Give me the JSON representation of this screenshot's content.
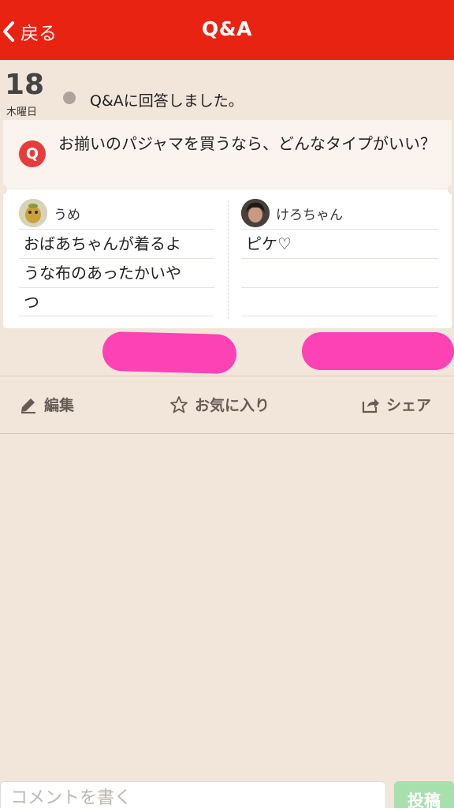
{
  "header": {
    "back_label": "戻る",
    "title": "Q&A"
  },
  "entry": {
    "date_number": "18",
    "weekday": "木曜日",
    "status_text": "Q&Aに回答しました。"
  },
  "question": {
    "badge": "Q",
    "text": "お揃いのパジャマを買うなら、どんなタイプがいい？"
  },
  "answers": [
    {
      "user": "うめ",
      "lines": [
        "おばあちゃんが着るよ",
        "うな布のあったかいや",
        "つ"
      ]
    },
    {
      "user": "けろちゃん",
      "lines": [
        "ピケ♡",
        "",
        ""
      ]
    }
  ],
  "actions": {
    "edit_label": "編集",
    "favorite_label": "お気に入り",
    "share_label": "シェア"
  },
  "comment": {
    "placeholder": "コメントを書く",
    "post_label": "投稿"
  },
  "colors": {
    "header_bg": "#e82311",
    "page_bg": "#f2e5da",
    "q_badge": "#e63c3c",
    "redaction": "#fd42b6",
    "post_button": "#a8e0ad"
  },
  "icons": [
    "chevron-left-icon",
    "pencil-icon",
    "star-icon",
    "share-icon"
  ]
}
